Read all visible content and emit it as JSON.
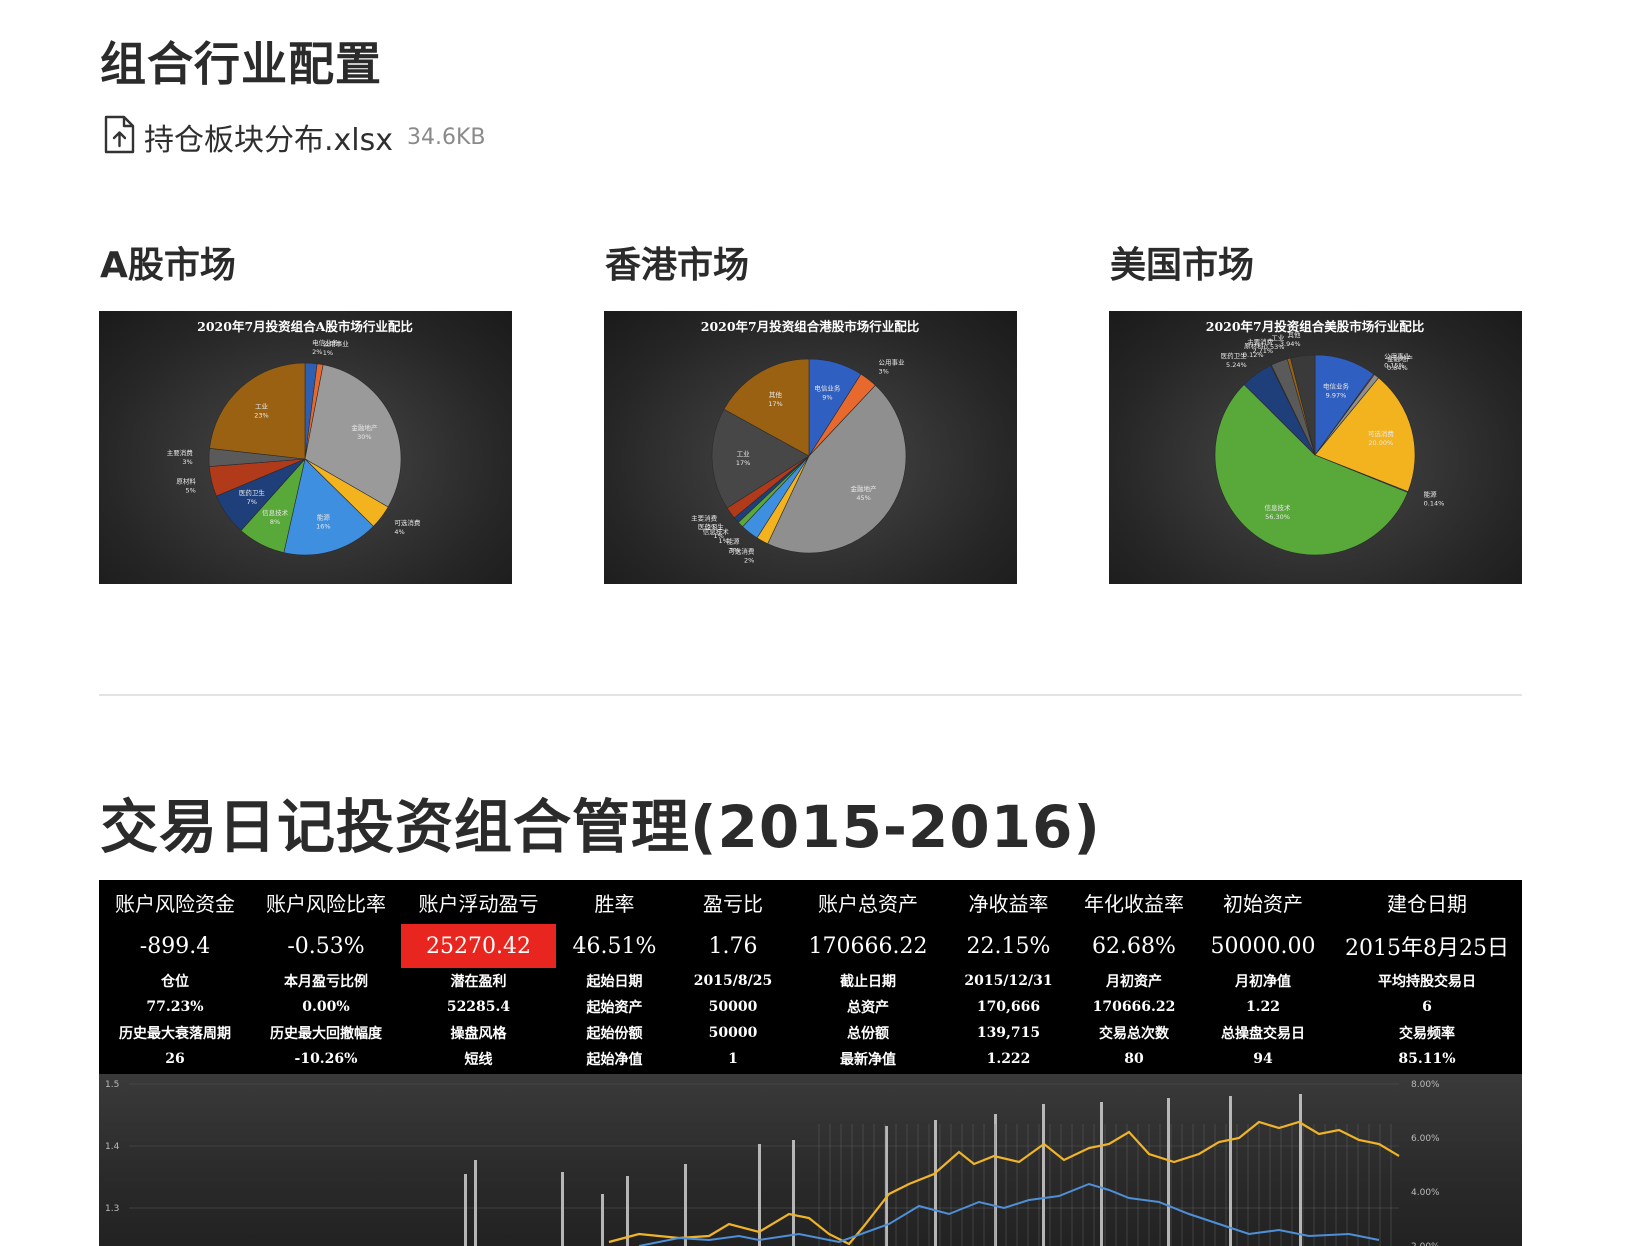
{
  "page": {
    "title": "组合行业配置",
    "attachment": {
      "name": "持仓板块分布.xlsx",
      "size": "34.6KB",
      "icon": "file-upload-icon"
    }
  },
  "markets": [
    {
      "title": "A股市场",
      "chart_title": "2020年7月投资组合A股市场行业配比",
      "slices": [
        {
          "label": "电信业务",
          "value": 2,
          "pct": "2%",
          "color": "#2f5fb3"
        },
        {
          "label": "公用事业",
          "value": 1,
          "pct": "1%",
          "color": "#e8692d"
        },
        {
          "label": "金融地产",
          "value": 30,
          "pct": "30%",
          "color": "#9a9a9a"
        },
        {
          "label": "可选消费",
          "value": 4,
          "pct": "4%",
          "color": "#f2b31f"
        },
        {
          "label": "能源",
          "value": 16,
          "pct": "16%",
          "color": "#3f8fe0"
        },
        {
          "label": "信息技术",
          "value": 8,
          "pct": "8%",
          "color": "#58a83a"
        },
        {
          "label": "医药卫生",
          "value": 7,
          "pct": "7%",
          "color": "#1f3f7a"
        },
        {
          "label": "原材料",
          "value": 5,
          "pct": "5%",
          "color": "#b03a1a"
        },
        {
          "label": "主要消费",
          "value": 3,
          "pct": "3%",
          "color": "#5a5a5a"
        },
        {
          "label": "工业",
          "value": 23,
          "pct": "23%",
          "color": "#9a6112"
        }
      ]
    },
    {
      "title": "香港市场",
      "chart_title": "2020年7月投资组合港股市场行业配比",
      "slices": [
        {
          "label": "电信业务",
          "value": 9,
          "pct": "9%",
          "color": "#2f5fc0"
        },
        {
          "label": "公用事业",
          "value": 3,
          "pct": "3%",
          "color": "#e8692d"
        },
        {
          "label": "金融地产",
          "value": 45,
          "pct": "45%",
          "color": "#8f8f8f"
        },
        {
          "label": "可选消费",
          "value": 2,
          "pct": "2%",
          "color": "#f2b31f"
        },
        {
          "label": "能源",
          "value": 3,
          "pct": "3%",
          "color": "#3f8fe0"
        },
        {
          "label": "信息技术",
          "value": 1,
          "pct": "1%",
          "color": "#58a83a"
        },
        {
          "label": "医药卫生",
          "value": 1,
          "pct": "1%",
          "color": "#1f3f7a"
        },
        {
          "label": "主要消费",
          "value": 2,
          "pct": "2%",
          "color": "#b03a1a"
        },
        {
          "label": "工业",
          "value": 17,
          "pct": "17%",
          "color": "#474747"
        },
        {
          "label": "其他",
          "value": 17,
          "pct": "17%",
          "color": "#9a6112"
        }
      ]
    },
    {
      "title": "美国市场",
      "chart_title": "2020年7月投资组合美股市场行业配比",
      "slices": [
        {
          "label": "电信业务",
          "value": 9.97,
          "pct": "9.97%",
          "color": "#2f5fc0"
        },
        {
          "label": "公用事业",
          "value": 0.15,
          "pct": "0.15%",
          "color": "#e8692d"
        },
        {
          "label": "金融地产",
          "value": 0.84,
          "pct": "0.84%",
          "color": "#8f8f8f"
        },
        {
          "label": "可选消费",
          "value": 20.0,
          "pct": "20.00%",
          "color": "#f2b31f"
        },
        {
          "label": "能源",
          "value": 0.14,
          "pct": "0.14%",
          "color": "#3f8fe0"
        },
        {
          "label": "信息技术",
          "value": 56.3,
          "pct": "56.30%",
          "color": "#58a83a"
        },
        {
          "label": "医药卫生",
          "value": 5.24,
          "pct": "5.24%",
          "color": "#1f3f7a"
        },
        {
          "label": "原材料",
          "value": 0.12,
          "pct": "0.12%",
          "color": "#b03a1a"
        },
        {
          "label": "主要消费",
          "value": 2.71,
          "pct": "2.71%",
          "color": "#5a5a5a"
        },
        {
          "label": "工业",
          "value": 0.53,
          "pct": "0.53%",
          "color": "#9a6112"
        },
        {
          "label": "其他",
          "value": 3.94,
          "pct": "3.94%",
          "color": "#3a3a3a"
        }
      ]
    }
  ],
  "journal": {
    "title": "交易日记投资组合管理(2015-2016)",
    "headers": [
      "账户风险资金",
      "账户风险比率",
      "账户浮动盈亏",
      "胜率",
      "盈亏比",
      "账户总资产",
      "净收益率",
      "年化收益率",
      "初始资产",
      "建仓日期"
    ],
    "values": [
      "-899.4",
      "-0.53%",
      "25270.42",
      "46.51%",
      "1.76",
      "170666.22",
      "22.15%",
      "62.68%",
      "50000.00",
      "2015年8月25日"
    ],
    "rows": [
      [
        "仓位",
        "本月盈亏比例",
        "潜在盈利",
        "起始日期",
        "2015/8/25",
        "截止日期",
        "2015/12/31",
        "月初资产",
        "月初净值",
        "平均持股交易日"
      ],
      [
        "77.23%",
        "0.00%",
        "52285.4",
        "起始资产",
        "50000",
        "总资产",
        "170,666",
        "170666.22",
        "1.22",
        "6"
      ],
      [
        "历史最大衰落周期",
        "历史最大回撤幅度",
        "操盘风格",
        "起始份额",
        "50000",
        "总份额",
        "139,715",
        "交易总次数",
        "总操盘交易日",
        "交易频率"
      ],
      [
        "26",
        "-10.26%",
        "短线",
        "起始净值",
        "1",
        "最新净值",
        "1.222",
        "80",
        "94",
        "85.11%"
      ]
    ],
    "chart": {
      "y_left_ticks": [
        "1.5",
        "1.4",
        "1.3"
      ],
      "y_right_ticks": [
        "8.00%",
        "6.00%",
        "4.00%",
        "2.00%"
      ],
      "series_colors": {
        "yellow": "#f0b428",
        "blue": "#4f8fd6",
        "bars": "#cfcfcf"
      }
    }
  }
}
